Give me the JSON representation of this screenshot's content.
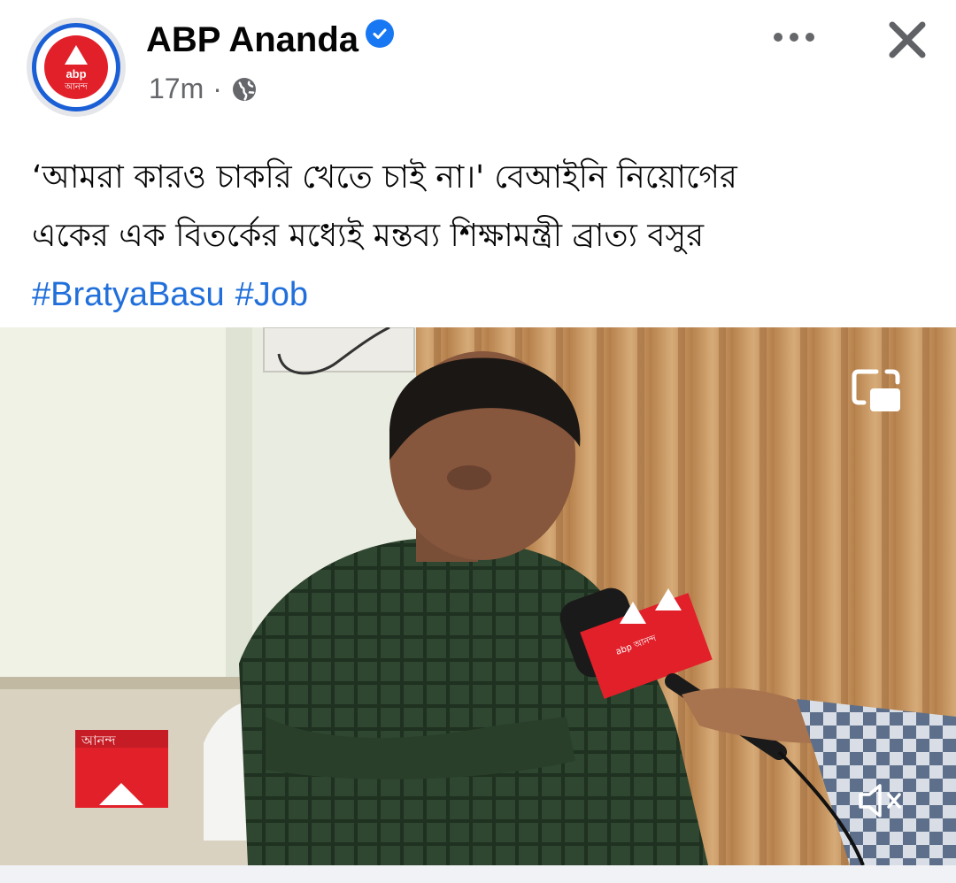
{
  "post": {
    "page_name": "ABP Ananda",
    "time": "17m",
    "separator": "·",
    "avatar": {
      "logo_text": "abp",
      "logo_sub": "আনন্দ"
    },
    "caption_line1": "‘আমরা কারও চাকরি খেতে চাই না।' বেআইনি নিয়োগের",
    "caption_line2": "একের এক বিতর্কের মধ্যেই মন্তব্য শিক্ষামন্ত্রী ব্রাত্য বসুর",
    "hashtags": [
      "#BratyaBasu",
      "#Job"
    ]
  },
  "video": {
    "channel_bug_text": "আনন্দ",
    "mic_flag_text": "abp আনন্দ",
    "muted": true
  },
  "icons": {
    "verified": "verified-badge-icon",
    "audience": "globe-icon",
    "more": "more-options-icon",
    "close": "close-icon",
    "pip": "picture-in-picture-icon",
    "mute": "muted-speaker-icon"
  },
  "colors": {
    "accent_blue": "#1877f2",
    "hashtag_blue": "#216fdb",
    "abp_red": "#e2202a",
    "meta_gray": "#65676b"
  }
}
